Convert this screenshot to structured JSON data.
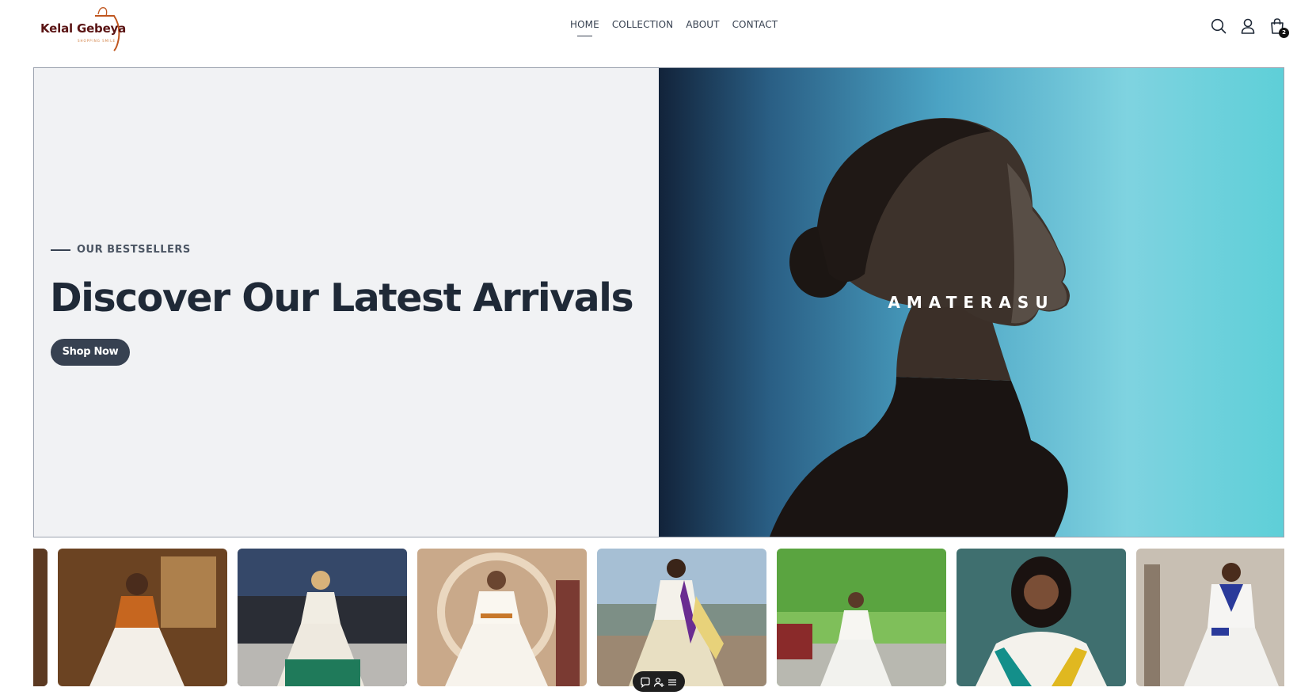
{
  "brand": {
    "logo_text": "Kelal Gebeya",
    "logo_subtext": "SHOPPING SMILE",
    "accent_color": "#c0561f",
    "dark_color": "#5a1414"
  },
  "nav": {
    "items": [
      {
        "label": "HOME",
        "active": true
      },
      {
        "label": "COLLECTION",
        "active": false
      },
      {
        "label": "ABOUT",
        "active": false
      },
      {
        "label": "CONTACT",
        "active": false
      }
    ]
  },
  "header_icons": {
    "search": "search-icon",
    "account": "user-icon",
    "cart": "shopping-bag-icon",
    "cart_count": "2"
  },
  "hero": {
    "eyebrow": "OUR BESTSELLERS",
    "title": "Discover Our Latest Arrivals",
    "cta_label": "Shop Now",
    "image_overlay_text": "AMATERASU"
  },
  "carousel": {
    "items": [
      {
        "theme": "traditional-dress-orange"
      },
      {
        "theme": "traditional-dress-green"
      },
      {
        "theme": "traditional-dress-white-embroidered"
      },
      {
        "theme": "traditional-dress-yellow-sash"
      },
      {
        "theme": "traditional-dress-park"
      },
      {
        "theme": "traditional-dress-teal-backdrop"
      },
      {
        "theme": "traditional-dress-blue-embroidered"
      }
    ]
  },
  "mini_toolbar": {
    "icons": [
      "comment-icon",
      "user-add-icon",
      "menu-icon"
    ]
  }
}
